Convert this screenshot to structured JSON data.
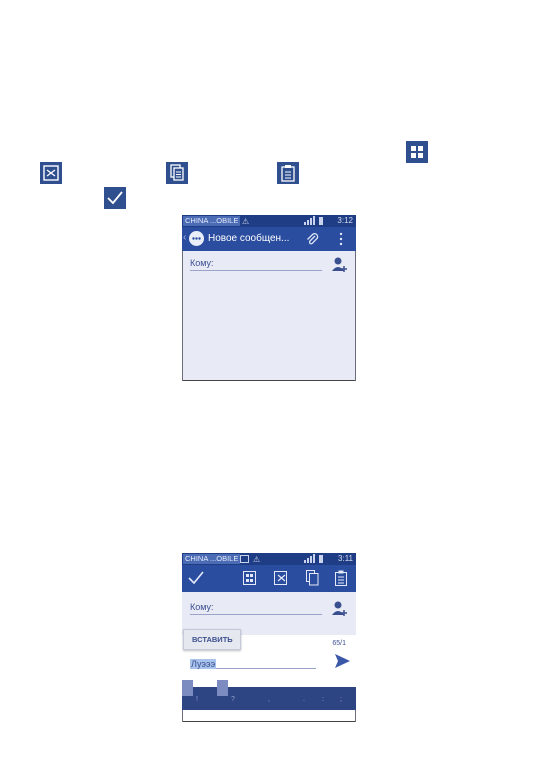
{
  "phone1": {
    "carrier": "CHINA ...OBILE",
    "time": "3:12",
    "title": "Новое сообщен...",
    "to_label": "Кому:"
  },
  "phone2": {
    "carrier": "CHINA ...OBILE",
    "time": "3:11",
    "to_label": "Кому:",
    "paste_label": "ВСТАВИТЬ",
    "char_count": "65/1",
    "typed_text": "Луэээ",
    "keys": [
      "!",
      "?",
      ",",
      ".",
      ":",
      ";"
    ]
  },
  "colors": {
    "accent": "#2b4da0",
    "status_bar": "#1f3d84",
    "content_bg": "#e8eaf6"
  }
}
